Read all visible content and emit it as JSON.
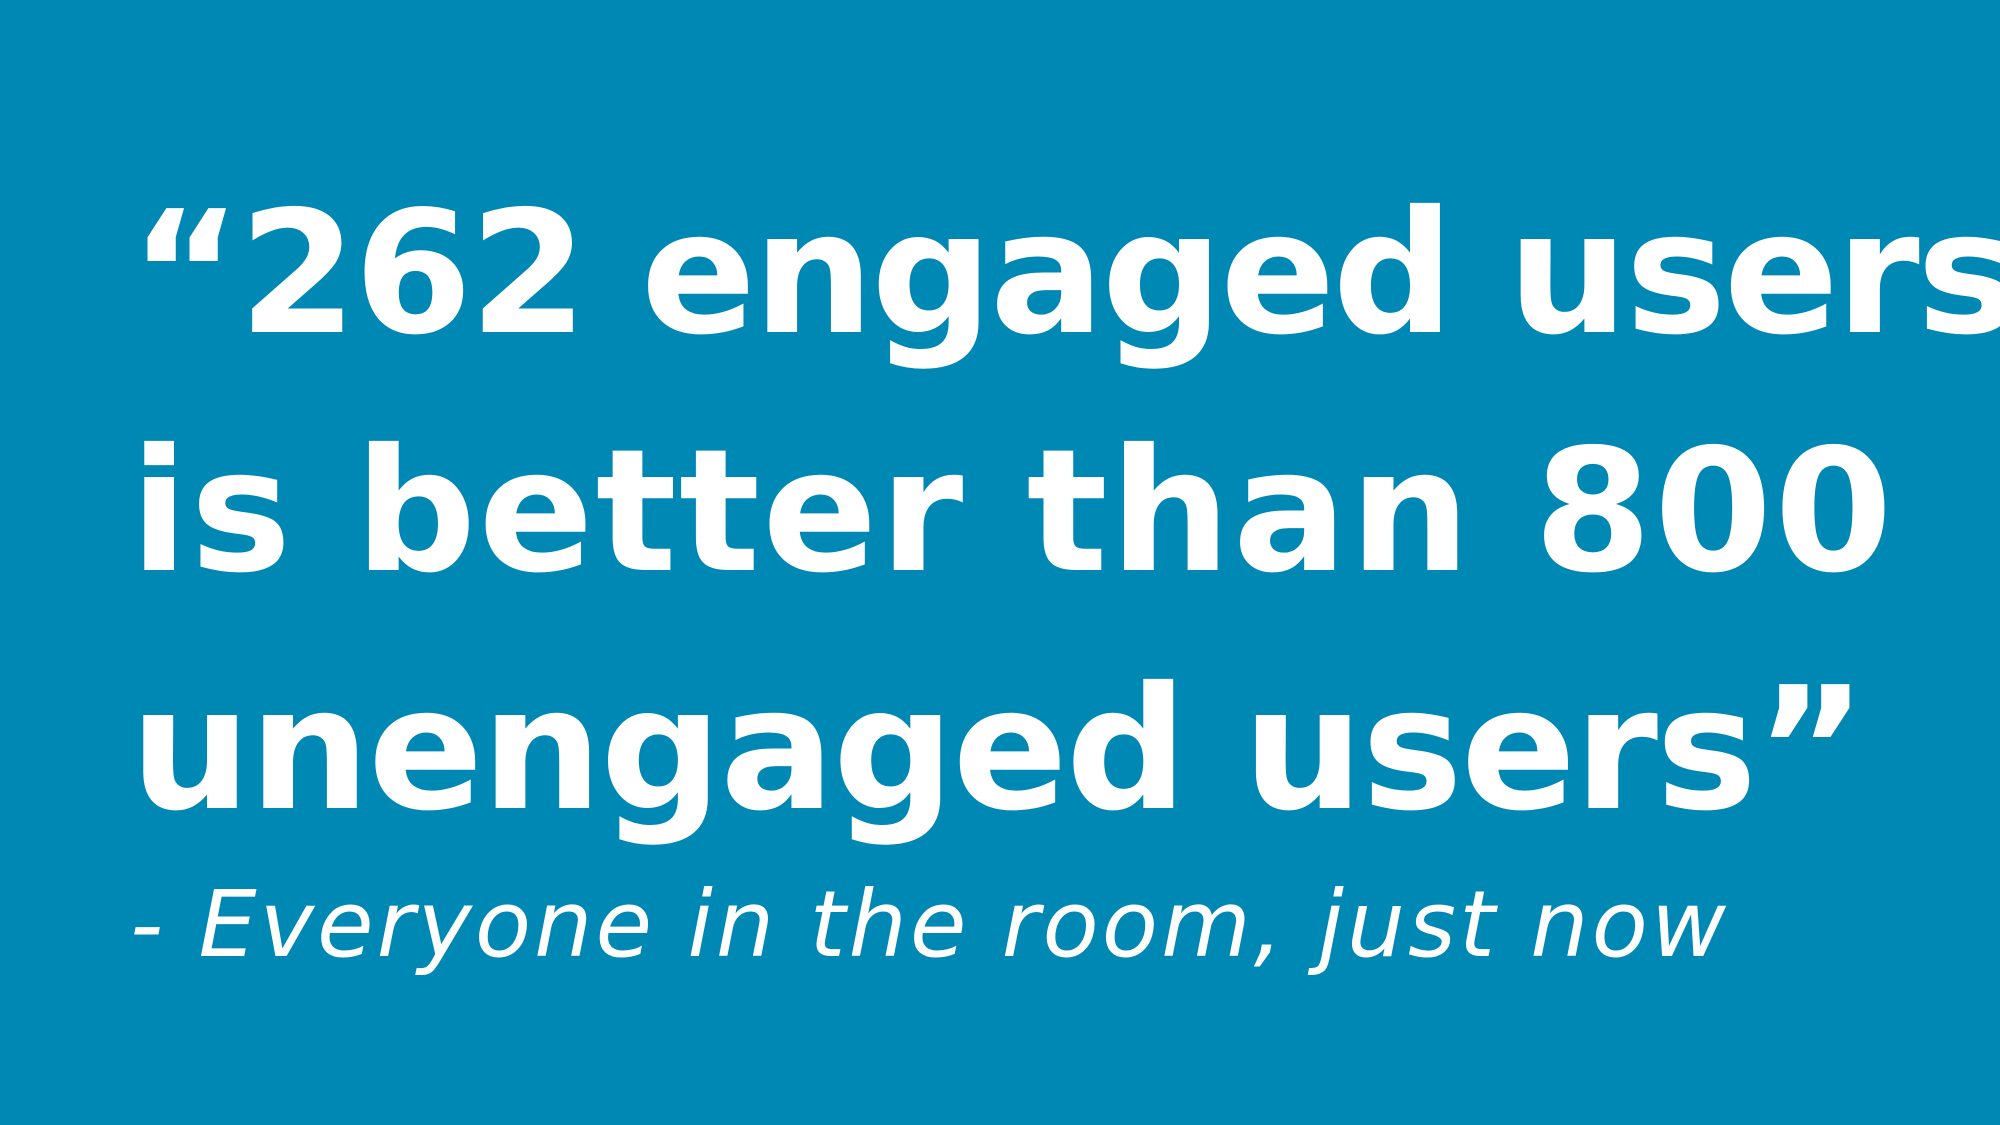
{
  "slide": {
    "background_color": "#0088b5",
    "text_color": "#ffffff",
    "quote": {
      "lines": [
        "“262 engaged users",
        "is better than 800",
        "unengaged users”"
      ]
    },
    "attribution": "- Everyone in the room, just now"
  }
}
